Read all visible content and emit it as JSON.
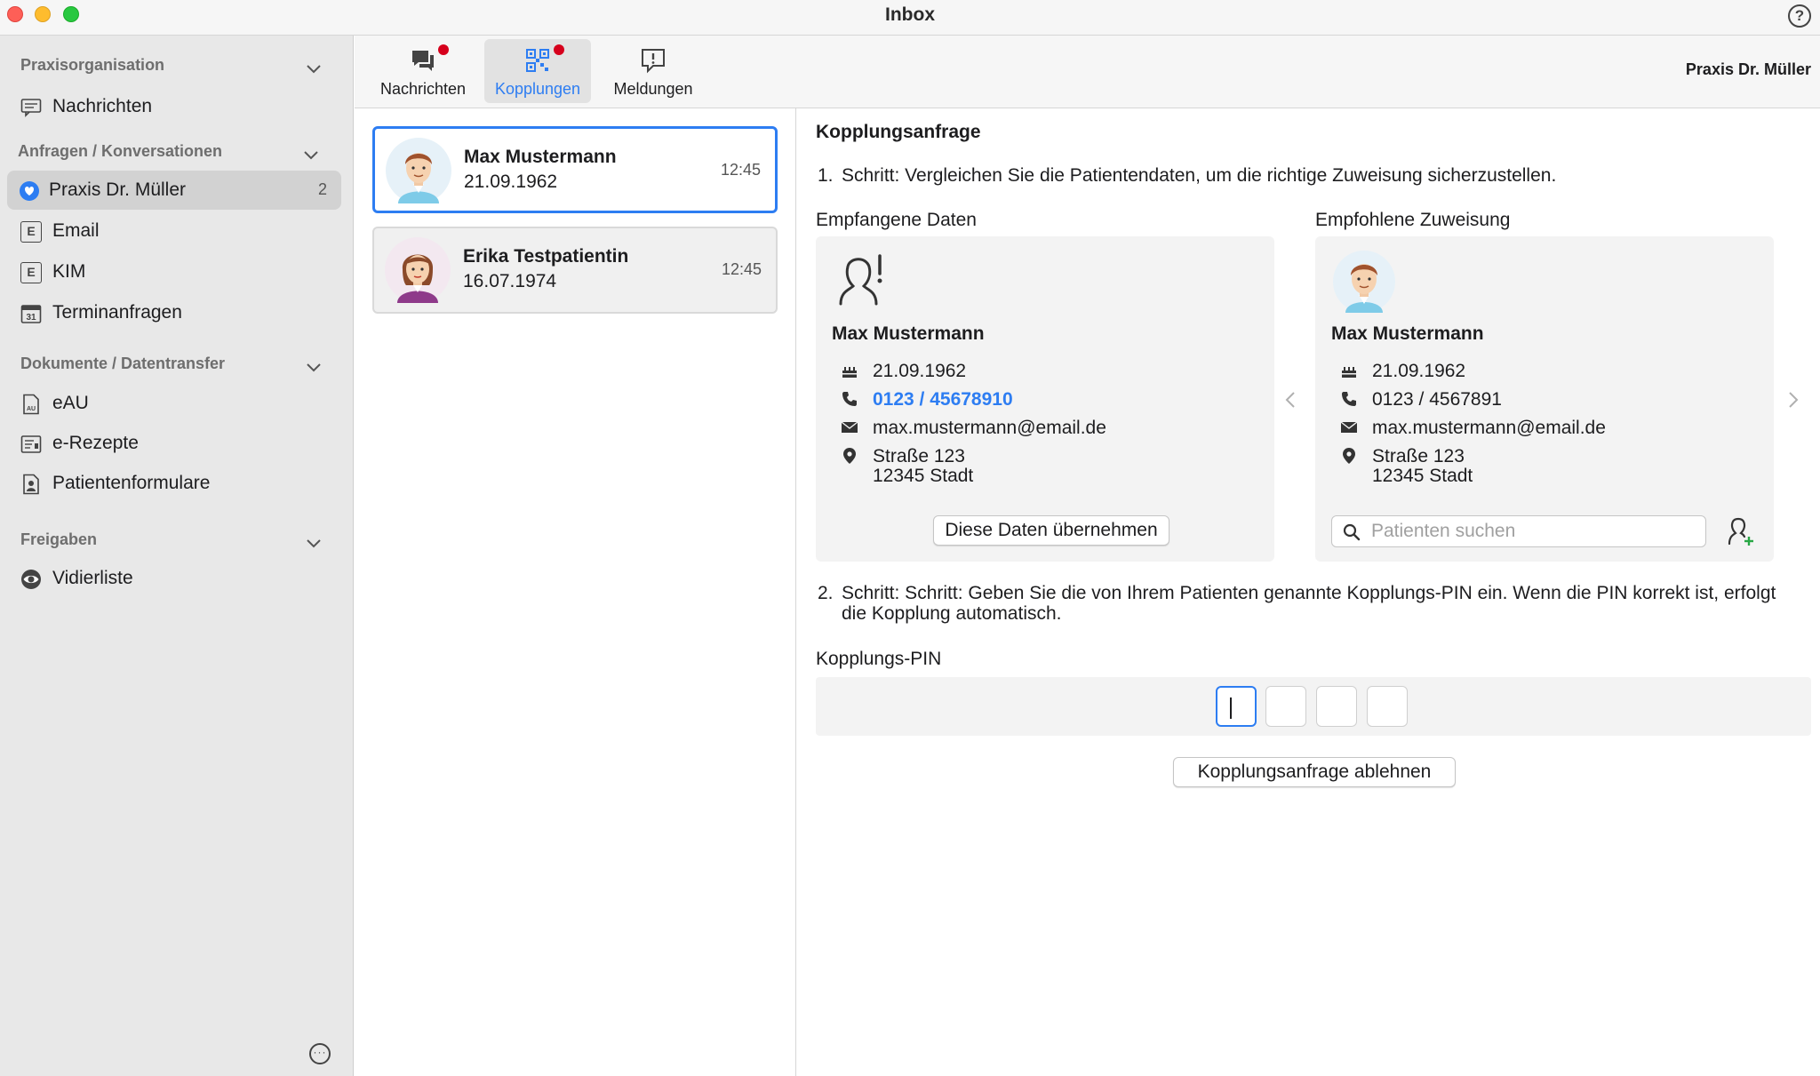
{
  "window": {
    "title": "Inbox",
    "help": "?"
  },
  "sidebar": {
    "sections": [
      {
        "title": "Praxisorganisation",
        "items": [
          {
            "label": "Nachrichten",
            "icon": "message-icon"
          }
        ]
      },
      {
        "title": "Anfragen / Konversationen",
        "items": [
          {
            "label": "Praxis Dr. Müller",
            "icon": "practice-logo-icon",
            "badge": "2",
            "active": true
          },
          {
            "label": "Email",
            "icon": "email-letter-icon",
            "glyph": "E"
          },
          {
            "label": "KIM",
            "icon": "kim-letter-icon",
            "glyph": "E"
          },
          {
            "label": "Terminanfragen",
            "icon": "calendar-icon",
            "glyph": "31"
          }
        ]
      },
      {
        "title": "Dokumente / Datentransfer",
        "items": [
          {
            "label": "eAU",
            "icon": "eau-document-icon",
            "glyph": "AU"
          },
          {
            "label": "e-Rezepte",
            "icon": "prescription-icon"
          },
          {
            "label": "Patientenformulare",
            "icon": "patient-form-icon"
          }
        ]
      },
      {
        "title": "Freigaben",
        "items": [
          {
            "label": "Vidierliste",
            "icon": "eye-icon"
          }
        ]
      }
    ],
    "more": "···"
  },
  "toolbar": {
    "tabs": [
      {
        "label": "Nachrichten",
        "icon": "chat-bubbles-icon",
        "dot": true
      },
      {
        "label": "Kopplungen",
        "icon": "qr-code-icon",
        "dot": true,
        "active": true
      },
      {
        "label": "Meldungen",
        "icon": "alert-message-icon",
        "dot": false
      }
    ],
    "practice": "Praxis Dr. Müller"
  },
  "conversations": [
    {
      "name": "Max Mustermann",
      "date": "21.09.1962",
      "time": "12:45",
      "selected": true
    },
    {
      "name": "Erika Testpatientin",
      "date": "16.07.1974",
      "time": "12:45",
      "selected": false
    }
  ],
  "detail": {
    "title": "Kopplungsanfrage",
    "step1": {
      "num": "1.",
      "text": "Schritt: Vergleichen Sie die Patientendaten, um die richtige Zuweisung sicherzustellen."
    },
    "received": {
      "heading": "Empfangene Daten",
      "name": "Max Mustermann",
      "birth": "21.09.1962",
      "phone": "0123 / 45678910",
      "email": "max.mustermann@email.de",
      "street": "Straße 123",
      "city": "12345 Stadt",
      "accept_button": "Diese Daten übernehmen"
    },
    "recommended": {
      "heading": "Empfohlene Zuweisung",
      "name": "Max Mustermann",
      "birth": "21.09.1962",
      "phone": "0123 / 4567891",
      "email": "max.mustermann@email.de",
      "street": "Straße 123",
      "city": "12345 Stadt",
      "search_placeholder": "Patienten suchen"
    },
    "step2": {
      "num": "2.",
      "text": "Schritt: Schritt: Geben Sie die von Ihrem Patienten genannte Kopplungs-PIN ein. Wenn die PIN korrekt ist, erfolgt die Kopplung automatisch."
    },
    "pin_label": "Kopplungs-PIN",
    "pin_values": [
      "",
      "",
      "",
      ""
    ],
    "reject_button": "Kopplungsanfrage ablehnen"
  },
  "colors": {
    "accent": "#2d7df2",
    "notification_dot": "#d6001c",
    "sidebar_bg": "#e8e8e8"
  }
}
